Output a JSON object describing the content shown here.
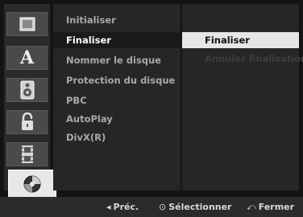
{
  "left_icons": [
    {
      "name": "disc-settings-icon"
    },
    {
      "name": "language-icon",
      "glyph": "A"
    },
    {
      "name": "audio-icon"
    },
    {
      "name": "lock-icon"
    },
    {
      "name": "film-icon"
    },
    {
      "name": "disc-icon",
      "selected": true
    }
  ],
  "menu": {
    "items": [
      {
        "label": "Initialiser"
      },
      {
        "label": "Finaliser",
        "active": true
      },
      {
        "label": "Nommer le disque"
      },
      {
        "label": "Protection du disque"
      },
      {
        "label": "PBC"
      },
      {
        "label": "AutoPlay"
      },
      {
        "label": "DivX(R)"
      }
    ]
  },
  "submenu": {
    "items": [
      {
        "label": "Finaliser",
        "highlight": true
      },
      {
        "label": "Annuler finalisation",
        "disabled": true
      }
    ]
  },
  "footer": {
    "prev_glyph": "◂",
    "prev_label": "Préc.",
    "select_glyph": "⊙",
    "select_label": "Sélectionner",
    "close_glyph": "⤺",
    "close_label": "Fermer"
  }
}
